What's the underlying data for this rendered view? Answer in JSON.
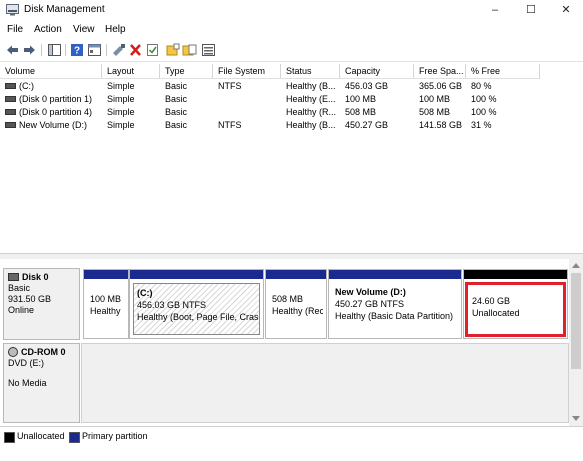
{
  "window": {
    "title": "Disk Management",
    "minimize_glyph": "–",
    "maximize_glyph": "☐",
    "close_glyph": "✕"
  },
  "menu": [
    "File",
    "Action",
    "View",
    "Help"
  ],
  "toolbar_icons": [
    "back-arrow-icon",
    "forward-arrow-icon",
    "console-tree-icon",
    "help-icon",
    "properties-icon",
    "connect-icon",
    "delete-icon",
    "check-icon",
    "new-folder-icon",
    "folder-check-icon",
    "list-view-icon"
  ],
  "volume_table": {
    "headers": [
      "Volume",
      "Layout",
      "Type",
      "File System",
      "Status",
      "Capacity",
      "Free Spa...",
      "% Free"
    ],
    "rows": [
      [
        "(C:)",
        "Simple",
        "Basic",
        "NTFS",
        "Healthy (B...",
        "456.03 GB",
        "365.06 GB",
        "80 %"
      ],
      [
        "(Disk 0 partition 1)",
        "Simple",
        "Basic",
        "",
        "Healthy (E...",
        "100 MB",
        "100 MB",
        "100 %"
      ],
      [
        "(Disk 0 partition 4)",
        "Simple",
        "Basic",
        "",
        "Healthy (R...",
        "508 MB",
        "508 MB",
        "100 %"
      ],
      [
        "New Volume (D:)",
        "Simple",
        "Basic",
        "NTFS",
        "Healthy (B...",
        "450.27 GB",
        "141.58 GB",
        "31 %"
      ]
    ]
  },
  "disks": [
    {
      "name": "Disk 0",
      "type": "Basic",
      "size": "931.50 GB",
      "state": "Online",
      "partitions": [
        {
          "title": "",
          "size": "100 MB",
          "status": "Healthy"
        },
        {
          "title": "(C:)",
          "size": "456.03 GB NTFS",
          "status": "Healthy (Boot, Page File, Crash"
        },
        {
          "title": "",
          "size": "508 MB",
          "status": "Healthy (Rec"
        },
        {
          "title": "New Volume  (D:)",
          "size": "450.27 GB NTFS",
          "status": "Healthy (Basic Data Partition)"
        },
        {
          "title": "",
          "size": "24.60 GB",
          "status": "Unallocated"
        }
      ]
    },
    {
      "name": "CD-ROM 0",
      "type": "DVD (E:)",
      "state": "No Media"
    }
  ],
  "legend": [
    {
      "label": "Unallocated",
      "color": "#000000"
    },
    {
      "label": "Primary partition",
      "color": "#1b2a8f"
    }
  ],
  "colors": {
    "primary_partition": "#1b2a8f",
    "unallocated": "#000000",
    "highlight": "#e0202a"
  }
}
